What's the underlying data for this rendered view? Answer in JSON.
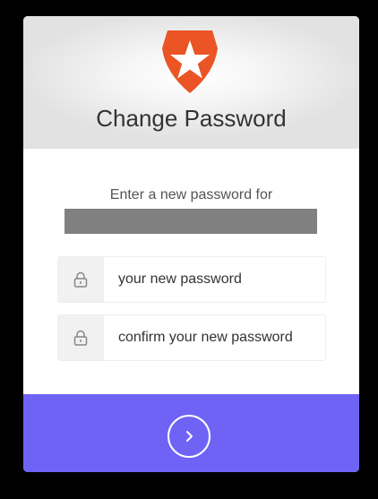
{
  "header": {
    "title": "Change Password",
    "logo_icon": "shield-star-icon",
    "logo_color": "#eb5424"
  },
  "form": {
    "prompt": "Enter a new password for",
    "new_password": {
      "value": "",
      "placeholder": "your new password",
      "icon": "lock-icon"
    },
    "confirm_password": {
      "value": "",
      "placeholder": "confirm your new password",
      "icon": "lock-icon"
    }
  },
  "submit": {
    "icon": "chevron-right-icon",
    "color": "#6f63f6"
  }
}
